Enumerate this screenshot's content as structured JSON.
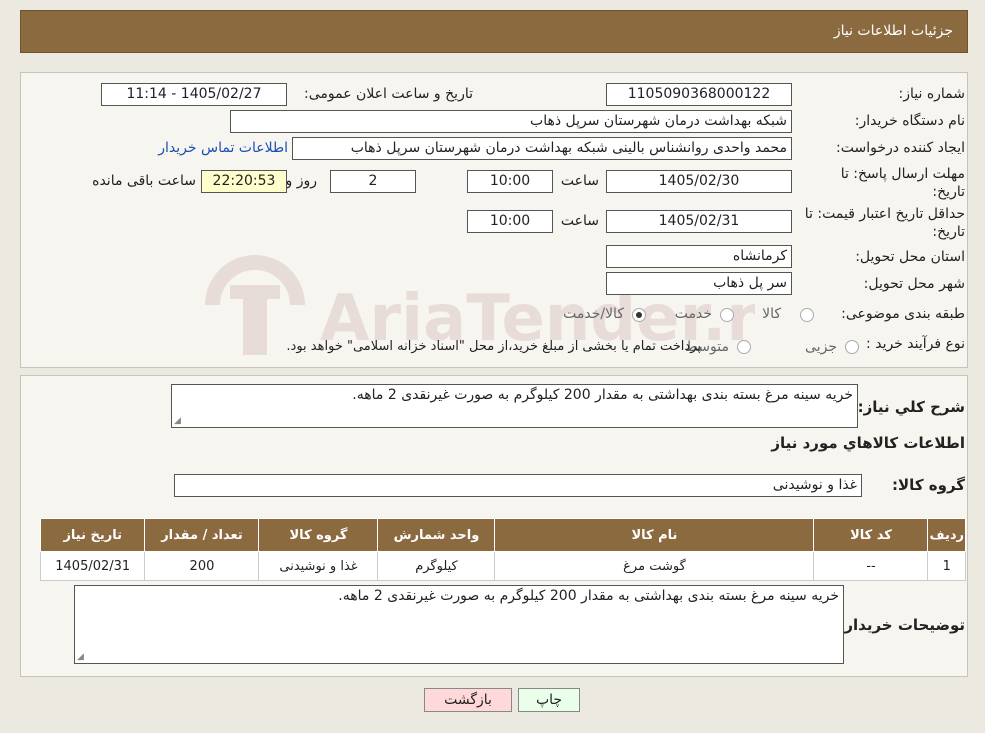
{
  "header": {
    "title": "جزئیات اطلاعات نیاز"
  },
  "form": {
    "need_number": {
      "label": "شماره نیاز:",
      "value": "1105090368000122"
    },
    "announce_datetime": {
      "label": "تاریخ و ساعت اعلان عمومی:",
      "value": "1405/02/27 - 11:14"
    },
    "buyer_org": {
      "label": "نام دستگاه خریدار:",
      "value": "شبکه بهداشت درمان شهرستان سرپل ذهاب"
    },
    "creator": {
      "label": "ایجاد کننده درخواست:",
      "value": "محمد واحدی روانشناس بالینی شبکه بهداشت درمان شهرستان سرپل ذهاب",
      "link": "اطلاعات تماس خریدار"
    },
    "reply_deadline": {
      "label": "مهلت ارسال پاسخ: تا تاریخ:",
      "date": "1405/02/30",
      "time_label": "ساعت",
      "time": "10:00",
      "days": "2",
      "days_label": "روز و",
      "remaining": "22:20:53",
      "remaining_label": "ساعت باقی مانده"
    },
    "price_validity": {
      "label": "حداقل تاریخ اعتبار قیمت: تا تاریخ:",
      "date": "1405/02/31",
      "time_label": "ساعت",
      "time": "10:00"
    },
    "province": {
      "label": "استان محل تحویل:",
      "value": "کرمانشاه"
    },
    "city": {
      "label": "شهر محل تحویل:",
      "value": "سر پل ذهاب"
    },
    "category": {
      "label": "طبقه بندی موضوعی:",
      "options": [
        "کالا",
        "خدمت",
        "کالا/خدمت"
      ]
    },
    "process_type": {
      "label": "نوع فرآیند خرید :",
      "options": [
        "جزیی",
        "متوسط"
      ],
      "note": "پرداخت تمام یا بخشی از مبلغ خرید،از محل \"اسناد خزانه اسلامی\" خواهد بود."
    }
  },
  "summary": {
    "label": "شرح کلي نياز:",
    "value": "خریه سینه مرغ بسته بندی بهداشتی به مقدار 200 کیلوگرم به صورت غیرنقدی 2 ماهه.",
    "goods_info_title": "اطلاعات کالاهاي مورد نياز",
    "goods_group_label": "گروه کالا:",
    "goods_group_value": "غذا و نوشیدنی"
  },
  "table": {
    "headers": [
      "رديف",
      "کد کالا",
      "نام کالا",
      "واحد شمارش",
      "گروه کالا",
      "تعداد / مقدار",
      "تاريخ نياز"
    ],
    "rows": [
      [
        "1",
        "--",
        "گوشت مرغ",
        "کیلوگرم",
        "غذا و نوشیدنی",
        "200",
        "1405/02/31"
      ]
    ]
  },
  "buyer_notes": {
    "label": "توضیحات خریدار:",
    "value": "خریه سینه مرغ بسته بندی بهداشتی به مقدار 200 کیلوگرم به صورت غیرنقدی 2 ماهه."
  },
  "buttons": {
    "print": "چاپ",
    "back": "بازگشت"
  },
  "watermark": {
    "text": "AriaTender.neT"
  }
}
